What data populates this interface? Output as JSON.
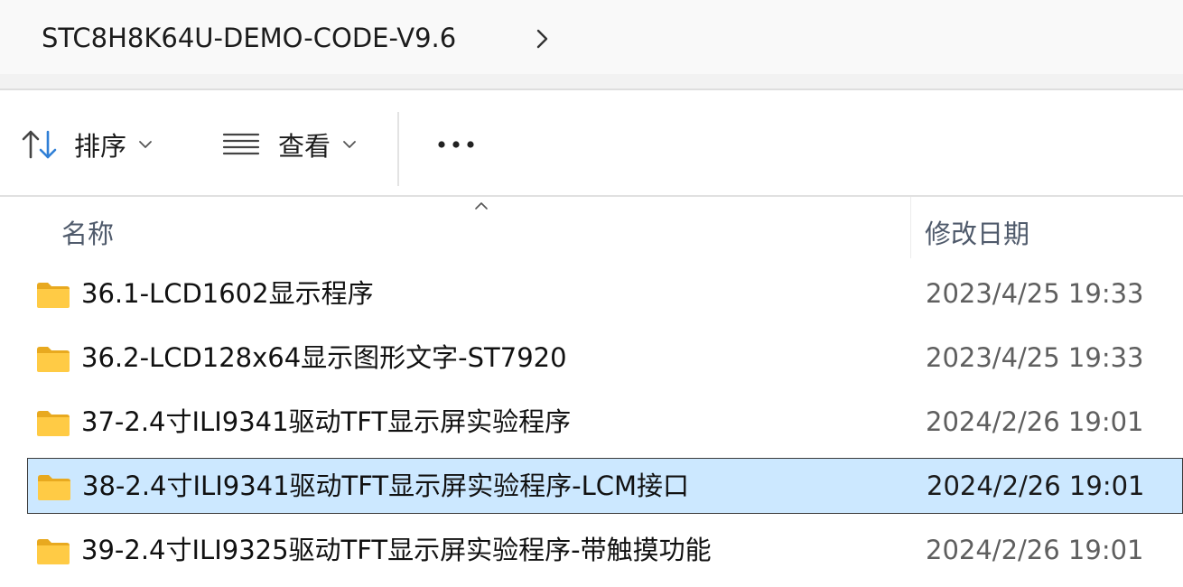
{
  "breadcrumb": {
    "current": "STC8H8K64U-DEMO-CODE-V9.6",
    "chevron_icon": "chevron-right-icon"
  },
  "commandbar": {
    "sort": {
      "label": "排序",
      "icon": "sort-arrows-icon"
    },
    "view": {
      "label": "查看",
      "icon": "view-lines-icon"
    },
    "more": {
      "label": "•••",
      "icon": "more-dots-icon"
    }
  },
  "columns": {
    "name": "名称",
    "date": "修改日期"
  },
  "files": [
    {
      "name": "36.1-LCD1602显示程序",
      "date": "2023/4/25 19:33",
      "selected": false
    },
    {
      "name": "36.2-LCD128x64显示图形文字-ST7920",
      "date": "2023/4/25 19:33",
      "selected": false
    },
    {
      "name": "37-2.4寸ILI9341驱动TFT显示屏实验程序",
      "date": "2024/2/26 19:01",
      "selected": false
    },
    {
      "name": "38-2.4寸ILI9341驱动TFT显示屏实验程序-LCM接口",
      "date": "2024/2/26 19:01",
      "selected": true
    },
    {
      "name": "39-2.4寸ILI9325驱动TFT显示屏实验程序-带触摸功能",
      "date": "2024/2/26 19:01",
      "selected": false
    }
  ],
  "colors": {
    "selection": "#cce8ff",
    "folder_yellow": "#ffc83d",
    "accent": "#2f7fd6"
  }
}
